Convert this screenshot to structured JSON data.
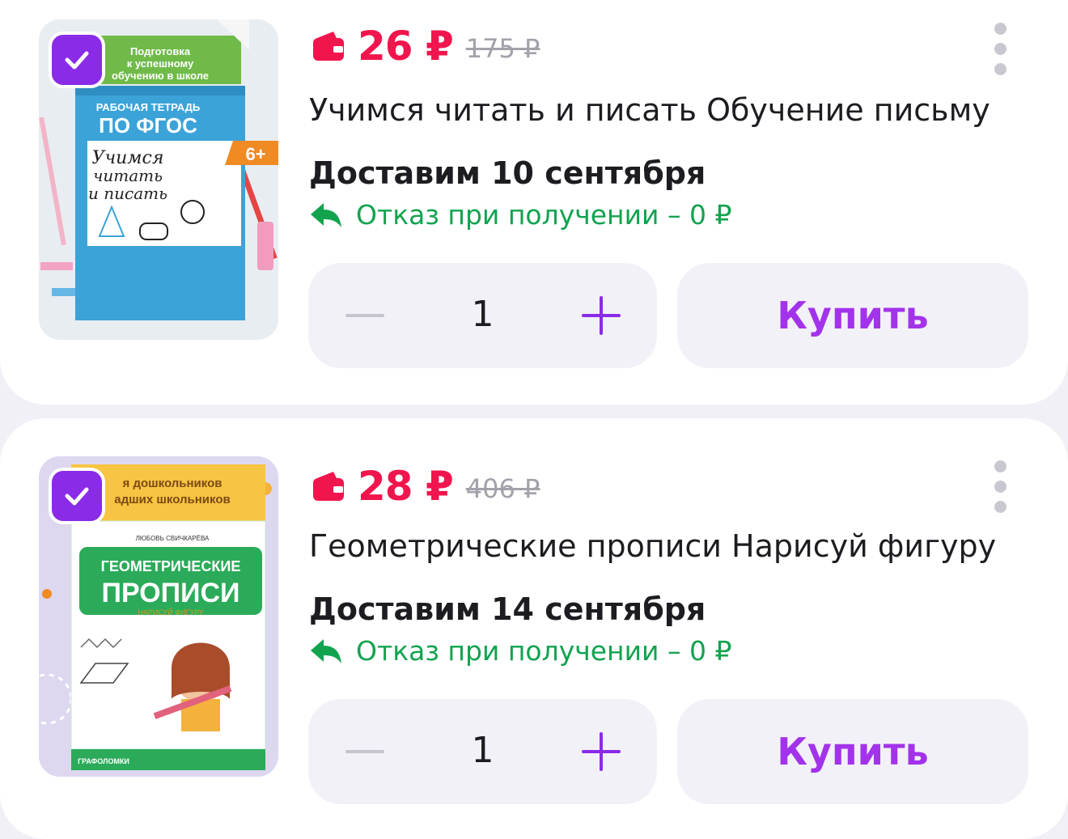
{
  "colors": {
    "accent": "#8a2be8",
    "price": "#f1154d",
    "refund": "#12a34f",
    "buy_text": "#a233ea",
    "background": "#f1f0f6"
  },
  "products": [
    {
      "image": {
        "banner": "Подготовка к успешному обучению в школе",
        "top_label": "РАБОЧАЯ ТЕТРАДЬ",
        "series": "ПО ФГОС",
        "cover_title": "Учимся читать и писать",
        "age": "6+"
      },
      "price": "26 ₽",
      "old_price": "175 ₽",
      "title": "Учимся читать и писать Обучение письму",
      "delivery": "Доставим 10 сентября",
      "refund": "Отказ при получении – 0 ₽",
      "quantity": "1",
      "buy_label": "Купить"
    },
    {
      "image": {
        "banner_line1": "я дошкольников",
        "banner_line2": "адших школьников",
        "author": "ЛЮБОВЬ СВИЧКАРЁВА",
        "cover_title_line1": "ГЕОМЕТРИЧЕСКИЕ",
        "cover_title_line2": "ПРОПИСИ",
        "subtitle": "НАРИСУЙ ФИГУРУ",
        "series": "ГРАФОЛОМКИ"
      },
      "price": "28 ₽",
      "old_price": "406 ₽",
      "title": "Геометрические прописи Нарисуй фигуру",
      "delivery": "Доставим 14 сентября",
      "refund": "Отказ при получении – 0 ₽",
      "quantity": "1",
      "buy_label": "Купить"
    }
  ],
  "icons": {
    "checkbox": "checkmark-icon",
    "price": "wallet-icon",
    "menu": "more-vertical-icon",
    "refund": "return-arrow-icon",
    "decrease": "minus-icon",
    "increase": "plus-icon"
  }
}
